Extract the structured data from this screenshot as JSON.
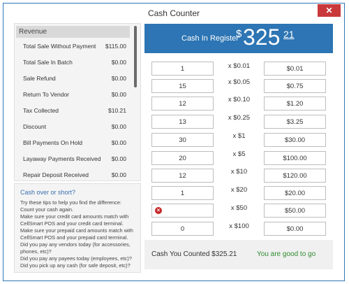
{
  "window": {
    "title": "Cash Counter",
    "close_label": "✕"
  },
  "revenue": {
    "header": "Revenue",
    "items": [
      {
        "label": "Total Sale Without Payment",
        "value": "$115.00"
      },
      {
        "label": "Total Sale In Batch",
        "value": "$0.00"
      },
      {
        "label": "Sale Refund",
        "value": "$0.00"
      },
      {
        "label": "Return To Vendor",
        "value": "$0.00"
      },
      {
        "label": "Tax Collected",
        "value": "$10.21"
      },
      {
        "label": "Discount",
        "value": "$0.00"
      },
      {
        "label": "Bill Payments On Hold",
        "value": "$0.00"
      },
      {
        "label": "Layaway Payments Received",
        "value": "$0.00"
      },
      {
        "label": "Repair Deposit Received",
        "value": "$0.00"
      }
    ]
  },
  "tips": {
    "title": "Cash over or short?",
    "lines": [
      "Try these tips to help you find the difference:",
      "Count your cash again.",
      "Make sure your credit card amounts match with",
      "CellSmart POS and your credit card terminal.",
      "Make sure your prepaid card amounts match with",
      "CellSmart POS and your prepaid card terminal.",
      "Did you pay any vendors today (for accessories,",
      "phones, etc)?",
      "Did you pay any payees today (employees, etc)?",
      "Did you pick up any cash (for safe deposit, etc)?"
    ]
  },
  "register": {
    "label": "Cash In Register",
    "dollar_sign": "$",
    "amount": "325",
    "cents": "21"
  },
  "denominations": [
    {
      "count": "1",
      "label": "x $0.01",
      "total": "$0.01"
    },
    {
      "count": "15",
      "label": "x $0.05",
      "total": "$0.75"
    },
    {
      "count": "12",
      "label": "x $0.10",
      "total": "$1.20"
    },
    {
      "count": "13",
      "label": "x $0.25",
      "total": "$3.25"
    },
    {
      "count": "30",
      "label": "x $1",
      "total": "$30.00"
    },
    {
      "count": "20",
      "label": "x $5",
      "total": "$100.00"
    },
    {
      "count": "12",
      "label": "x $10",
      "total": "$120.00"
    },
    {
      "count": "1",
      "label": "x $20",
      "total": "$20.00"
    },
    {
      "count": "",
      "label": "x $50",
      "total": "$50.00"
    },
    {
      "count": "0",
      "label": "x $100",
      "total": "$0.00"
    }
  ],
  "footer": {
    "counted": "Cash You Counted $325.21",
    "status": "You are good to go"
  },
  "colors": {
    "accent": "#2d75b4",
    "close": "#c9383a",
    "success": "#2e8b2e",
    "error": "#c62828"
  }
}
